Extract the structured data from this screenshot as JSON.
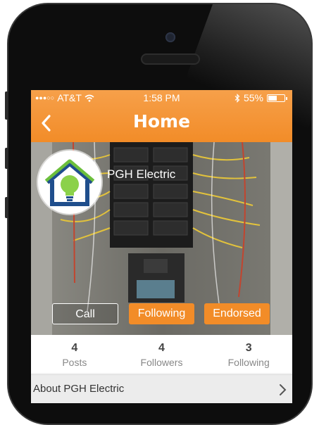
{
  "status_bar": {
    "signal": "●●●○○",
    "carrier": "AT&T",
    "time": "1:58 PM",
    "battery_percent": "55%",
    "battery_level": 0.55
  },
  "nav": {
    "title": "Home",
    "back_icon": "chevron-left-icon"
  },
  "profile": {
    "name": "PGH Electric",
    "logo": "house-lightbulb-logo",
    "cover": "electrical-panel-photo"
  },
  "actions": {
    "call": "Call",
    "following": "Following",
    "endorsed": "Endorsed"
  },
  "stats": [
    {
      "value": "4",
      "label": "Posts"
    },
    {
      "value": "4",
      "label": "Followers"
    },
    {
      "value": "3",
      "label": "Following"
    }
  ],
  "about": {
    "label": "About PGH Electric"
  },
  "colors": {
    "accent": "#f28c28",
    "logo_blue": "#1f4e8c",
    "logo_green": "#6cbf3c"
  }
}
